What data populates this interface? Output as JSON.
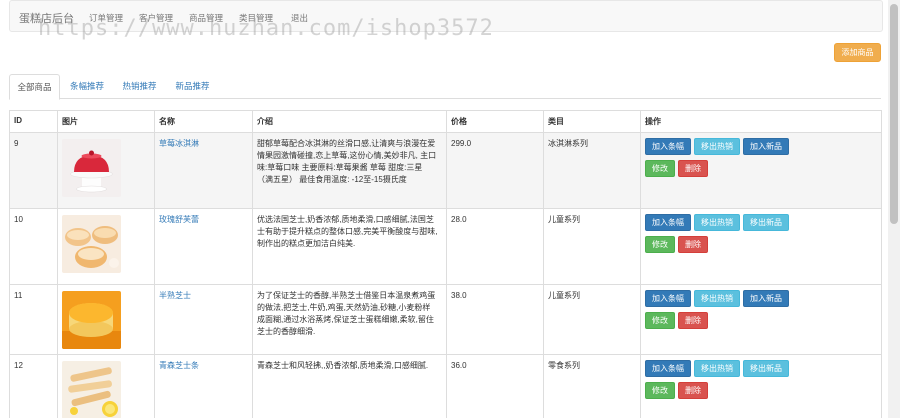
{
  "nav": {
    "brand": "蛋糕店后台",
    "links": [
      "订单管理",
      "客户管理",
      "商品管理",
      "类目管理",
      "退出"
    ]
  },
  "watermark": "https://www.huzhan.com/ishop3572",
  "add_button": "添加商品",
  "tabs": [
    "全部商品",
    "条幅推荐",
    "热销推荐",
    "新品推荐"
  ],
  "table": {
    "headers": [
      "ID",
      "图片",
      "名称",
      "介绍",
      "价格",
      "类目",
      "操作"
    ],
    "rows": [
      {
        "id": "9",
        "name": "草莓冰淇淋",
        "desc": "甜郁草莓配合冰淇淋的丝滑口感,让清爽与浪漫在爱情果园激情碰撞,恋上草莓,这份心情,美妙非凡, 主口味:草莓口味 主要原料:草莓果酱 草莓 甜度:三星（满五星） 最佳食用温度: -12至-15摄氏度",
        "price": "299.0",
        "category": "冰淇淋系列",
        "ops": [
          "加入条幅",
          "移出热销",
          "加入新品",
          "修改",
          "删除"
        ],
        "image": "red-mousse-cake"
      },
      {
        "id": "10",
        "name": "玫瑰舒芙蕾",
        "desc": "优选法国芝士,奶香浓郁,质地柔滑,口感细腻,法国芝士有助于提升糕点的整体口感,完美平衡酸度与甜味,制作出的糕点更加洁白纯美.",
        "price": "28.0",
        "category": "儿童系列",
        "ops": [
          "加入条幅",
          "移出热销",
          "移出新品",
          "修改",
          "删除"
        ],
        "image": "souffle-cakes"
      },
      {
        "id": "11",
        "name": "半熟芝士",
        "desc": "为了保证芝士的香醇,半熟芝士借鉴日本温泉煮鸡蛋的做法,把芝士,牛奶,鸡蛋,天然奶油,砂糖,小麦粉样成面糊,通过水浴蒸烤,保证芝士蛋糕细嫩,柔软,留住芝士的香醇细滑.",
        "price": "38.0",
        "category": "儿童系列",
        "ops": [
          "加入条幅",
          "移出热销",
          "加入新品",
          "修改",
          "删除"
        ],
        "image": "half-cooked-cheese"
      },
      {
        "id": "12",
        "name": "青森芝士条",
        "desc": "青森芝士和风轻拂,,奶香浓郁,质地柔滑,口感细腻.",
        "price": "36.0",
        "category": "零食系列",
        "ops": [
          "加入条幅",
          "移出热销",
          "移出新品",
          "修改",
          "删除"
        ],
        "image": "cheese-sticks"
      }
    ]
  },
  "colors": {
    "link": "#337ab7",
    "primary": "#337ab7",
    "info": "#5bc0de",
    "success": "#5cb85c",
    "danger": "#d9534f",
    "warning": "#f0ad4e"
  }
}
